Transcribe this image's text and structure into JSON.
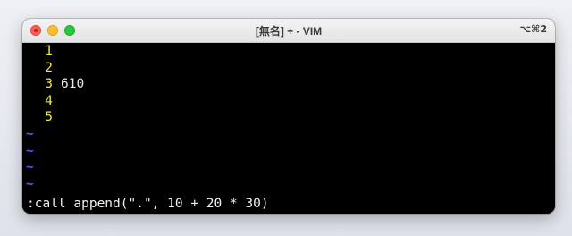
{
  "window": {
    "title": "[無名] + - VIM",
    "shortcut": "⌥⌘2"
  },
  "editor": {
    "lines": [
      {
        "number": "1",
        "text": ""
      },
      {
        "number": "2",
        "text": ""
      },
      {
        "number": "3",
        "text": "610"
      },
      {
        "number": "4",
        "text": ""
      },
      {
        "number": "5",
        "text": ""
      }
    ],
    "tildes": [
      "~",
      "~",
      "~",
      "~"
    ],
    "command_line": ":call append(\".\", 10 + 20 * 30)"
  },
  "colors": {
    "line_number": "#f0e54a",
    "tilde": "#5a5aff",
    "background": "#000000",
    "text": "#e8e8e8"
  }
}
